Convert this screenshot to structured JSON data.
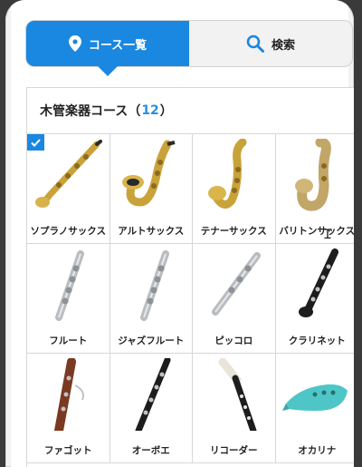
{
  "tabs": {
    "course_list": "コース一覧",
    "search": "検索"
  },
  "card": {
    "title": "木管楽器コース",
    "count": "12",
    "open_paren": "（",
    "close_paren": "）"
  },
  "instruments": [
    {
      "label": "ソプラノサックス",
      "icon": "soprano-sax",
      "selected": true
    },
    {
      "label": "アルトサックス",
      "icon": "alto-sax",
      "selected": false
    },
    {
      "label": "テナーサックス",
      "icon": "tenor-sax",
      "selected": false
    },
    {
      "label": "バリトンサックス",
      "icon": "baritone-sax",
      "selected": false
    },
    {
      "label": "フルート",
      "icon": "flute",
      "selected": false
    },
    {
      "label": "ジャズフルート",
      "icon": "jazz-flute",
      "selected": false
    },
    {
      "label": "ピッコロ",
      "icon": "piccolo",
      "selected": false
    },
    {
      "label": "クラリネット",
      "icon": "clarinet",
      "selected": false
    },
    {
      "label": "ファゴット",
      "icon": "bassoon",
      "selected": false
    },
    {
      "label": "オーボエ",
      "icon": "oboe",
      "selected": false
    },
    {
      "label": "リコーダー",
      "icon": "recorder",
      "selected": false
    },
    {
      "label": "オカリナ",
      "icon": "ocarina",
      "selected": false
    }
  ],
  "colors": {
    "accent": "#1a87e0",
    "count": "#2a8ee0",
    "gold": "#c9a23a",
    "silver": "#b9bcc0",
    "black": "#1d1d1d",
    "wood": "#7a3a22",
    "ocarina": "#4ec6c7"
  }
}
